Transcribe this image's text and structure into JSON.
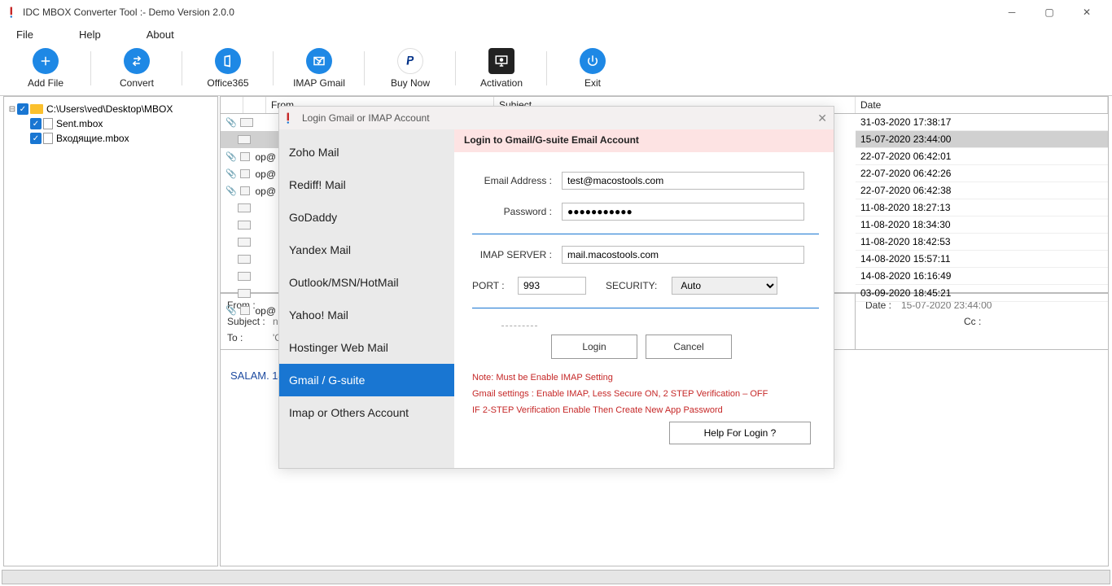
{
  "window": {
    "title": "IDC MBOX Converter Tool  :- Demo Version 2.0.0"
  },
  "menu": {
    "file": "File",
    "help": "Help",
    "about": "About"
  },
  "toolbar": {
    "add": "Add File",
    "convert": "Convert",
    "office365": "Office365",
    "imap": "IMAP Gmail",
    "buy": "Buy Now",
    "activation": "Activation",
    "exit": "Exit"
  },
  "tree": {
    "root": "C:\\Users\\ved\\Desktop\\MBOX",
    "items": [
      "Sent.mbox",
      "Входящие.mbox"
    ]
  },
  "grid": {
    "headers": {
      "from": "From",
      "subject": "Subject",
      "date": "Date"
    },
    "from_fragments": [
      "",
      "",
      "op@",
      "op@",
      "op@",
      "",
      "",
      "",
      "",
      "",
      "",
      "op@"
    ],
    "dates": [
      "31-03-2020 17:38:17",
      "15-07-2020 23:44:00",
      "22-07-2020 06:42:01",
      "22-07-2020 06:42:26",
      "22-07-2020 06:42:38",
      "11-08-2020 18:27:13",
      "11-08-2020 18:34:30",
      "11-08-2020 18:42:53",
      "14-08-2020 15:57:11",
      "14-08-2020 16:16:49",
      "03-09-2020 18:45:21"
    ],
    "selected_index": 1
  },
  "preview": {
    "from_label": "From :",
    "subject_label": "Subject :",
    "subject_value": "note",
    "to_label": "To :",
    "to_value": "'Cansu",
    "date_label": "Date :",
    "date_value": "15-07-2020 23:44:00",
    "cc_label": "Cc :",
    "body": "SALAM. 14"
  },
  "dialog": {
    "title": "Login Gmail or IMAP Account",
    "providers": [
      "Zoho Mail",
      "Rediff! Mail",
      "GoDaddy",
      "Yandex Mail",
      "Outlook/MSN/HotMail",
      "Yahoo! Mail",
      "Hostinger Web Mail",
      "Gmail / G-suite",
      "Imap or Others Account"
    ],
    "active_provider_index": 7,
    "banner": "Login to Gmail/G-suite Email Account",
    "labels": {
      "email": "Email Address :",
      "password": "Password :",
      "server": "IMAP SERVER :",
      "port": "PORT :",
      "security": "SECURITY:"
    },
    "values": {
      "email": "test@macostools.com",
      "password": "●●●●●●●●●●●",
      "server": "mail.macostools.com",
      "port": "993",
      "security": "Auto"
    },
    "login_btn": "Login",
    "cancel_btn": "Cancel",
    "notes": [
      "Note: Must be Enable IMAP Setting",
      "Gmail settings : Enable IMAP, Less Secure ON, 2 STEP Verification – OFF",
      "IF 2-STEP Verification Enable Then Create New App Password"
    ],
    "help_btn": "Help For Login ?"
  }
}
